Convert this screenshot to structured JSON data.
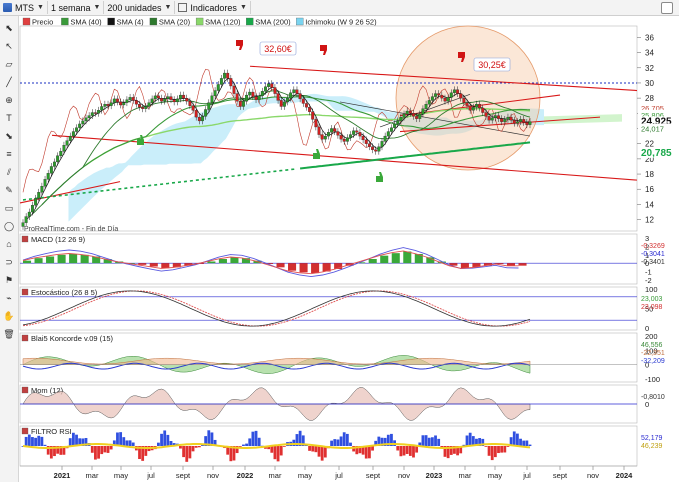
{
  "toolbar": {
    "symbol": "MTS",
    "period": "1 semana",
    "units": "200 unidades",
    "indicators": "Indicadores"
  },
  "legend": [
    {
      "label": "Precio",
      "color": "#e04040"
    },
    {
      "label": "SMA (40)",
      "color": "#3a9a3a"
    },
    {
      "label": "SMA (4)",
      "color": "#111111"
    },
    {
      "label": "SMA (20)",
      "color": "#2e7a2e"
    },
    {
      "label": "SMA (120)",
      "color": "#8ad86a"
    },
    {
      "label": "SMA (200)",
      "color": "#19a84a"
    },
    {
      "label": "Ichimoku (W 9 26 52)",
      "color": "#7ad4f0"
    }
  ],
  "annotations": {
    "high1": "32,60€",
    "high2": "30,25€"
  },
  "chart_data": [
    {
      "type": "candlestick",
      "panel": "price",
      "x_ticks": [
        "2021",
        "mar",
        "may",
        "jul",
        "sept",
        "nov",
        "2022",
        "mar",
        "may",
        "jul",
        "sept",
        "nov",
        "2023",
        "mar",
        "may",
        "jul",
        "sept",
        "nov",
        "2024"
      ],
      "y_ticks": [
        12,
        14,
        16,
        18,
        20,
        22,
        24,
        26,
        28,
        30,
        32,
        34,
        36
      ],
      "ylim": [
        10.5,
        37.5
      ],
      "price_labels": [
        {
          "text": "26,705",
          "value": 26.7,
          "color": "#c04030"
        },
        {
          "text": "25,806",
          "value": 25.8,
          "color": "#3a9a3a"
        },
        {
          "text": "24,925",
          "value": 24.925,
          "color": "#111111"
        },
        {
          "text": "24,017",
          "value": 24.0,
          "color": "#2e7a2e"
        },
        {
          "text": "20,785",
          "value": 20.785,
          "color": "#19a84a"
        }
      ],
      "close": [
        11.6,
        12.4,
        13.0,
        13.9,
        14.8,
        15.6,
        16.4,
        17.3,
        18.1,
        19.0,
        19.6,
        20.4,
        21.0,
        21.8,
        22.4,
        23.0,
        23.6,
        24.1,
        24.6,
        25.0,
        25.4,
        25.7,
        26.1,
        26.0,
        26.4,
        26.9,
        27.2,
        27.0,
        27.4,
        27.9,
        27.5,
        27.1,
        27.4,
        27.8,
        28.1,
        27.7,
        27.2,
        26.8,
        26.6,
        26.9,
        27.4,
        27.9,
        28.3,
        28.0,
        27.6,
        27.9,
        28.2,
        27.8,
        27.5,
        27.9,
        28.4,
        28.0,
        27.6,
        27.0,
        26.4,
        25.5,
        25.0,
        25.6,
        26.5,
        27.4,
        28.3,
        29.0,
        29.8,
        30.6,
        31.3,
        30.6,
        29.6,
        28.6,
        27.6,
        26.9,
        27.6,
        28.4,
        28.8,
        28.2,
        27.8,
        28.3,
        28.9,
        29.5,
        29.9,
        29.4,
        28.6,
        27.7,
        26.9,
        27.5,
        28.0,
        28.7,
        29.1,
        28.6,
        27.9,
        27.3,
        26.8,
        26.2,
        25.2,
        24.2,
        23.2,
        22.6,
        23.0,
        23.5,
        24.0,
        23.6,
        23.1,
        22.6,
        22.3,
        22.8,
        23.2,
        23.7,
        23.5,
        23.0,
        22.5,
        22.0,
        21.6,
        21.2,
        21.0,
        21.6,
        22.3,
        23.0,
        23.6,
        24.1,
        24.6,
        25.0,
        25.5,
        25.9,
        26.3,
        26.0,
        25.6,
        25.3,
        25.9,
        26.6,
        27.2,
        27.7,
        28.2,
        28.6,
        28.4,
        28.0,
        27.6,
        28.1,
        28.7,
        29.1,
        28.6,
        28.0,
        27.4,
        27.0,
        26.4,
        26.8,
        27.2,
        26.7,
        26.1,
        25.6,
        25.1,
        25.4,
        25.7,
        25.3,
        24.9,
        25.2,
        25.5,
        25.1,
        24.7,
        24.9,
        25.2,
        24.8,
        24.5,
        24.9
      ],
      "series": [
        {
          "name": "SMA (4)",
          "color": "#111111"
        },
        {
          "name": "SMA (20)",
          "color": "#2e7a2e"
        },
        {
          "name": "SMA (40)",
          "color": "#3a9a3a"
        },
        {
          "name": "SMA (120)",
          "color": "#8ad86a"
        },
        {
          "name": "SMA (200)",
          "color": "#19a84a"
        },
        {
          "name": "Ichimoku (W 9 26 52)",
          "color": "#7ad4f0"
        }
      ]
    },
    {
      "type": "bar+line",
      "panel": "MACD",
      "title": "MACD (12 26 9)",
      "y_ticks": [
        3,
        2,
        1,
        0,
        -1,
        -2
      ],
      "ylim": [
        -2.5,
        3.5
      ],
      "value_labels": [
        "-0,3269",
        "-0,3041",
        "-0,3401"
      ],
      "hist": [
        0.3,
        0.6,
        0.8,
        1.0,
        1.1,
        1.0,
        0.8,
        0.5,
        0.2,
        0.0,
        -0.2,
        -0.4,
        -0.6,
        -0.5,
        -0.3,
        -0.1,
        0.2,
        0.5,
        0.7,
        0.6,
        0.3,
        -0.1,
        -0.5,
        -0.9,
        -1.1,
        -1.2,
        -1.0,
        -0.7,
        -0.3,
        0.1,
        0.5,
        0.9,
        1.2,
        1.4,
        1.1,
        0.7,
        0.2,
        -0.3,
        -0.6,
        -0.5,
        -0.3,
        -0.1,
        -0.3,
        -0.3
      ]
    },
    {
      "type": "line",
      "panel": "Estocastico",
      "title": "Estocástico (26 8 5)",
      "y_ticks": [
        100,
        50,
        0
      ],
      "ylim": [
        -5,
        105
      ],
      "value_labels": [
        "23,003",
        "23,098"
      ]
    },
    {
      "type": "area",
      "panel": "Blai5 Koncorde",
      "title": "Blai5 Koncorde v.09 (15)",
      "y_ticks": [
        200,
        100,
        0,
        -100
      ],
      "ylim": [
        -120,
        220
      ],
      "value_labels": [
        "46,556",
        "-22,351",
        "-32,209"
      ]
    },
    {
      "type": "area",
      "panel": "Mom",
      "title": "Mom (12)",
      "y_ticks": [
        0
      ],
      "ylim": [
        -5,
        5
      ],
      "value_labels": [
        "-0,8010"
      ]
    },
    {
      "type": "line",
      "panel": "FILTRO RSI",
      "title": "FILTRO RSI",
      "y_ticks": [],
      "value_labels": [
        "52,179",
        "46,239"
      ]
    }
  ],
  "watermark": "ProRealTime.com - Fin de Día"
}
